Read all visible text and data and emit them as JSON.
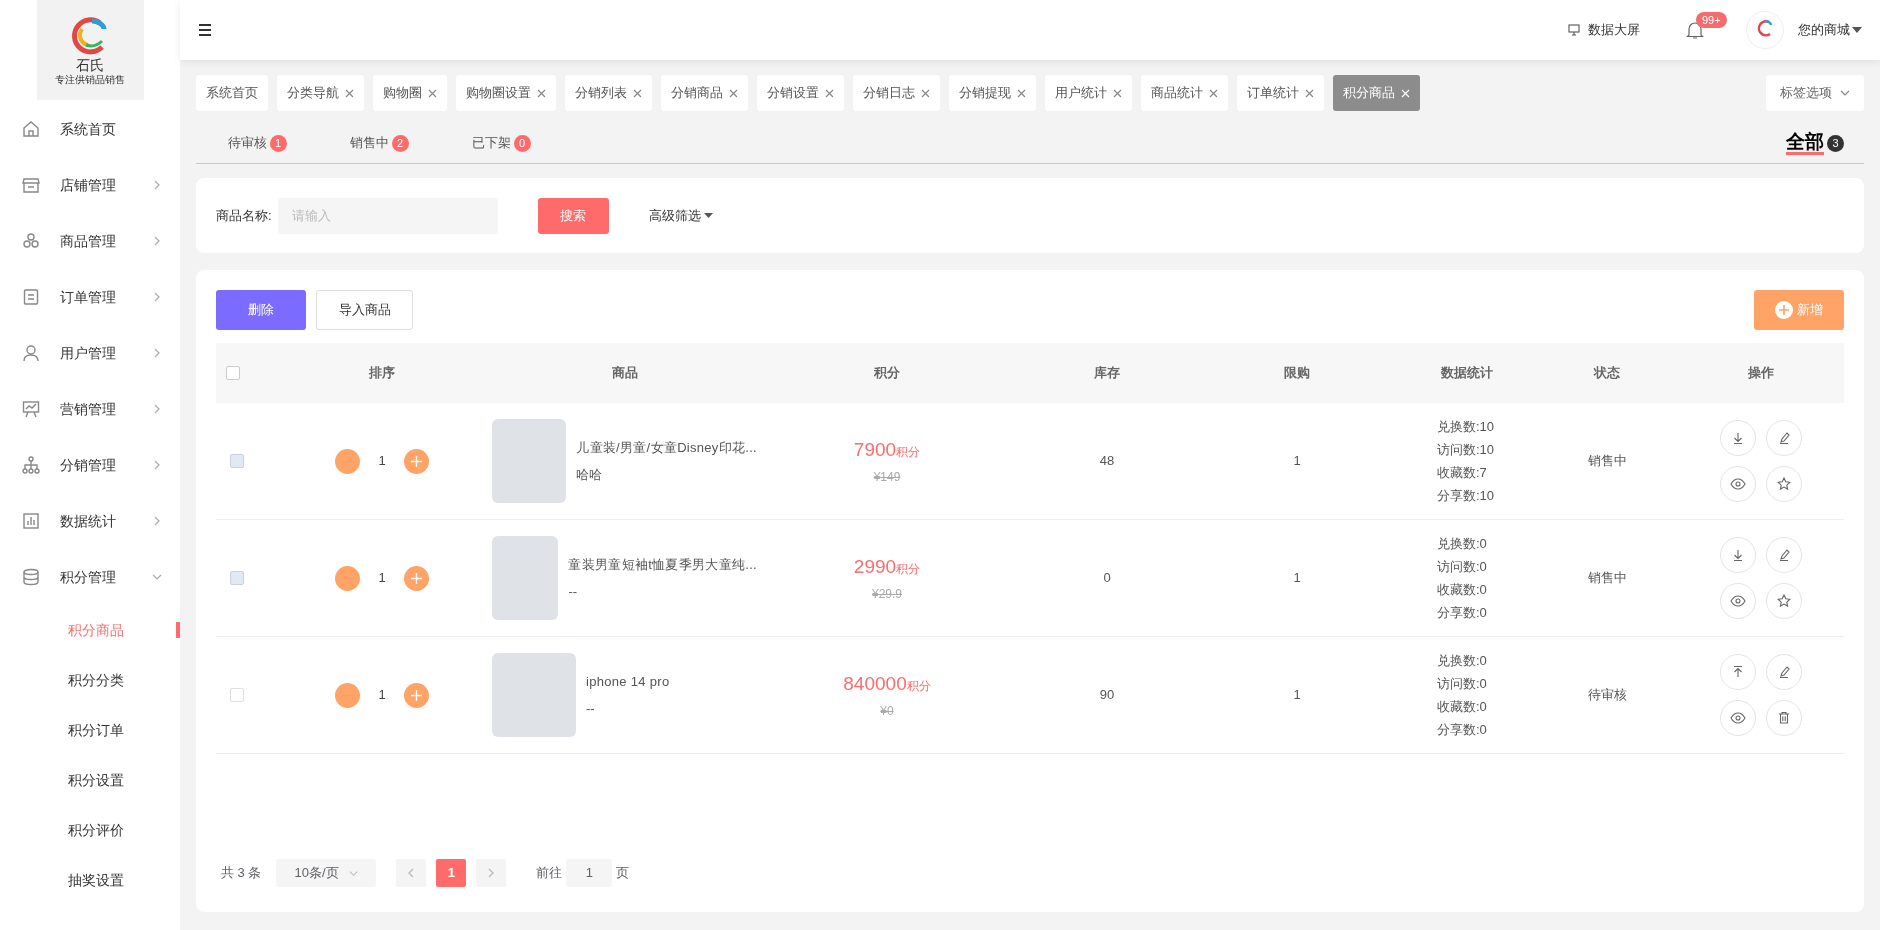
{
  "logo": {
    "title": "石氏",
    "subtitle": "专注供销品销售"
  },
  "sidebar": {
    "items": [
      {
        "label": "系统首页",
        "kind": "link"
      },
      {
        "label": "店铺管理",
        "kind": "menu",
        "expanded": false
      },
      {
        "label": "商品管理",
        "kind": "menu",
        "expanded": false
      },
      {
        "label": "订单管理",
        "kind": "menu",
        "expanded": false
      },
      {
        "label": "用户管理",
        "kind": "menu",
        "expanded": false
      },
      {
        "label": "营销管理",
        "kind": "menu",
        "expanded": false
      },
      {
        "label": "分销管理",
        "kind": "menu",
        "expanded": false
      },
      {
        "label": "数据统计",
        "kind": "menu",
        "expanded": false
      },
      {
        "label": "积分管理",
        "kind": "menu",
        "expanded": true,
        "children": [
          {
            "label": "积分商品",
            "selected": true
          },
          {
            "label": "积分分类",
            "selected": false
          },
          {
            "label": "积分订单",
            "selected": false
          },
          {
            "label": "积分设置",
            "selected": false
          },
          {
            "label": "积分评价",
            "selected": false
          },
          {
            "label": "抽奖设置",
            "selected": false
          }
        ]
      }
    ]
  },
  "header": {
    "screen_link": "数据大屏",
    "notification_badge": "99+",
    "user_menu": "您的商城"
  },
  "page_tags": [
    {
      "label": "系统首页",
      "closable": false,
      "selected": false
    },
    {
      "label": "分类导航",
      "closable": true,
      "selected": false
    },
    {
      "label": "购物圈",
      "closable": true,
      "selected": false
    },
    {
      "label": "购物圈设置",
      "closable": true,
      "selected": false
    },
    {
      "label": "分销列表",
      "closable": true,
      "selected": false
    },
    {
      "label": "分销商品",
      "closable": true,
      "selected": false
    },
    {
      "label": "分销设置",
      "closable": true,
      "selected": false
    },
    {
      "label": "分销日志",
      "closable": true,
      "selected": false
    },
    {
      "label": "分销提现",
      "closable": true,
      "selected": false
    },
    {
      "label": "用户统计",
      "closable": true,
      "selected": false
    },
    {
      "label": "商品统计",
      "closable": true,
      "selected": false
    },
    {
      "label": "订单统计",
      "closable": true,
      "selected": false
    },
    {
      "label": "积分商品",
      "closable": true,
      "selected": true
    }
  ],
  "tag_options": "标签选项",
  "status_tabs": [
    {
      "label": "待审核",
      "count": "1",
      "selected": false
    },
    {
      "label": "销售中",
      "count": "2",
      "selected": false
    },
    {
      "label": "已下架",
      "count": "0",
      "selected": false
    },
    {
      "label": "全部",
      "count": "3",
      "selected": true
    }
  ],
  "search": {
    "label": "商品名称:",
    "placeholder": "请输入",
    "button": "搜索",
    "advanced": "高级筛选"
  },
  "toolbar": {
    "delete": "删除",
    "import": "导入商品",
    "add": "新增"
  },
  "table": {
    "select_all_checked": false,
    "columns": [
      "排序",
      "商品",
      "积分",
      "库存",
      "限购",
      "数据统计",
      "状态",
      "操作"
    ],
    "rows": [
      {
        "checked": false,
        "disabled": true,
        "sort": "1",
        "name": "儿童装/男童/女童Disney印花...",
        "subtitle": "哈哈",
        "points": "7900",
        "points_unit": "积分",
        "price": "¥149",
        "stock": "48",
        "limit": "1",
        "stats": [
          "兑换数:10",
          "访问数:10",
          "收藏数:7",
          "分享数:10"
        ],
        "status": "销售中",
        "actions": [
          {
            "kind": "download"
          },
          {
            "kind": "edit"
          },
          {
            "kind": "view"
          },
          {
            "kind": "star"
          }
        ]
      },
      {
        "checked": false,
        "disabled": true,
        "sort": "1",
        "name": "童装男童短袖t恤夏季男大童纯...",
        "subtitle": "--",
        "points": "2990",
        "points_unit": "积分",
        "price": "¥29.9",
        "stock": "0",
        "limit": "1",
        "stats": [
          "兑换数:0",
          "访问数:0",
          "收藏数:0",
          "分享数:0"
        ],
        "status": "销售中",
        "actions": [
          {
            "kind": "download"
          },
          {
            "kind": "edit"
          },
          {
            "kind": "view"
          },
          {
            "kind": "star"
          }
        ]
      },
      {
        "checked": false,
        "disabled": false,
        "sort": "1",
        "name": "iphone 14 pro",
        "subtitle": "--",
        "points": "840000",
        "points_unit": "积分",
        "price": "¥0",
        "stock": "90",
        "limit": "1",
        "stats": [
          "兑换数:0",
          "访问数:0",
          "收藏数:0",
          "分享数:0"
        ],
        "status": "待审核",
        "actions": [
          {
            "kind": "upload"
          },
          {
            "kind": "edit"
          },
          {
            "kind": "view"
          },
          {
            "kind": "delete"
          }
        ]
      }
    ]
  },
  "pagination": {
    "total": "共 3 条",
    "page_size": "10条/页",
    "pages": [
      {
        "label": "1",
        "selected": true
      }
    ],
    "goto_label": "前往",
    "goto_value": "1",
    "goto_suffix": "页"
  }
}
